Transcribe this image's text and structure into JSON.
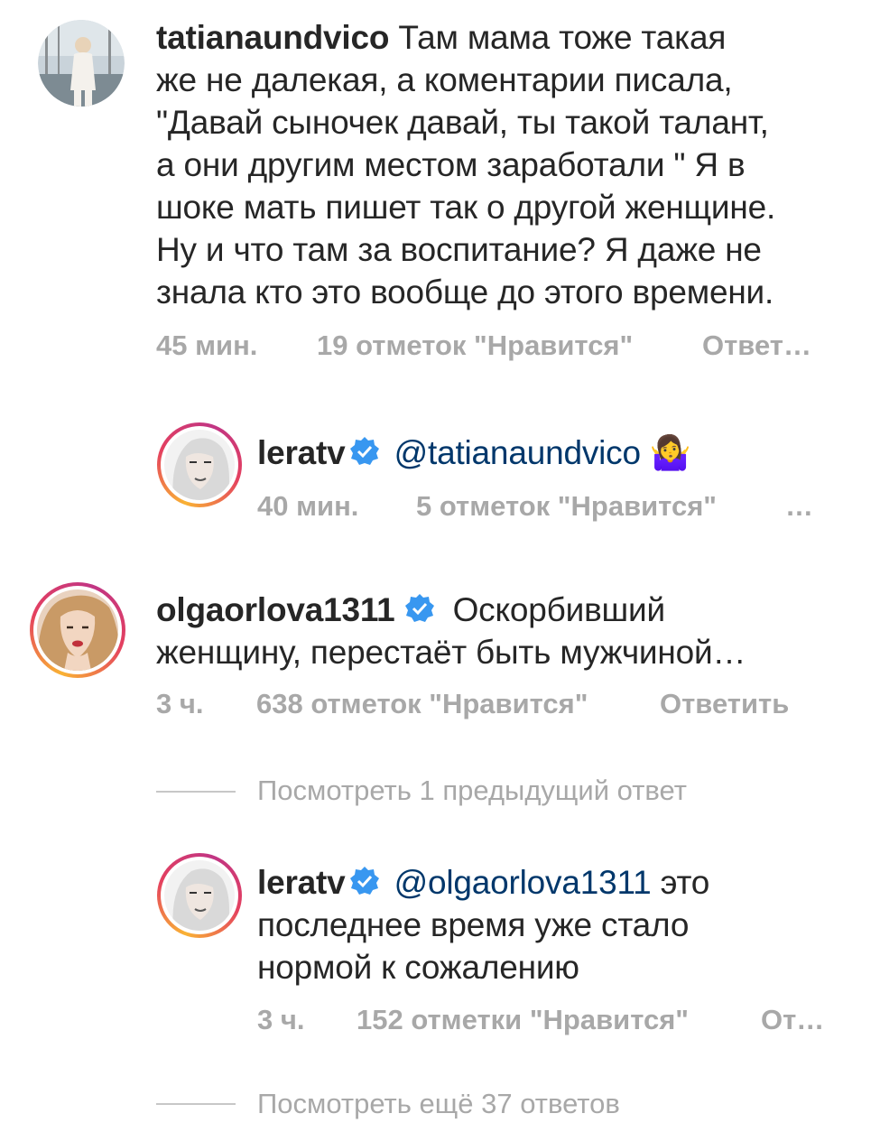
{
  "comments": [
    {
      "username": "tatianaundvico",
      "text_lines": [
        "Там мама тоже такая",
        "же не далекая, а коментарии писала,",
        "\"Давай сыночек давай, ты такой талант,",
        "а они другим местом заработали \" Я в",
        "шоке мать пишет так о другой женщине.",
        "Ну и что там за воспитание? Я даже не",
        "знала кто это вообще  до этого времени."
      ],
      "time": "45 мин.",
      "likes": "19 отметок \"Нравится\"",
      "reply": "Ответ…"
    },
    {
      "username": "leratv",
      "mention": "@tatianaundvico",
      "emoji": "🤷‍♀️",
      "time": "40 мин.",
      "likes": "5 отметок \"Нравится\"",
      "more": "…"
    },
    {
      "username": "olgaorlova1311",
      "text_line1": "Оскорбивший",
      "text_line2": "женщину, перестаёт быть мужчиной…",
      "time": "3 ч.",
      "likes": "638 отметок \"Нравится\"",
      "reply": "Ответить"
    },
    {
      "view_previous": "Посмотреть 1 предыдущий ответ"
    },
    {
      "username": "leratv",
      "mention": "@olgaorlova1311",
      "text_line1": "это",
      "text_line2": "последнее время уже стало",
      "text_line3": "нормой к сожалению",
      "time": "3 ч.",
      "likes": "152 отметки \"Нравится\"",
      "reply": "От…"
    },
    {
      "view_more": "Посмотреть ещё 37 ответов"
    }
  ],
  "colors": {
    "verified": "#3897f0",
    "mention": "#00376b",
    "meta": "#a8a8a8"
  }
}
